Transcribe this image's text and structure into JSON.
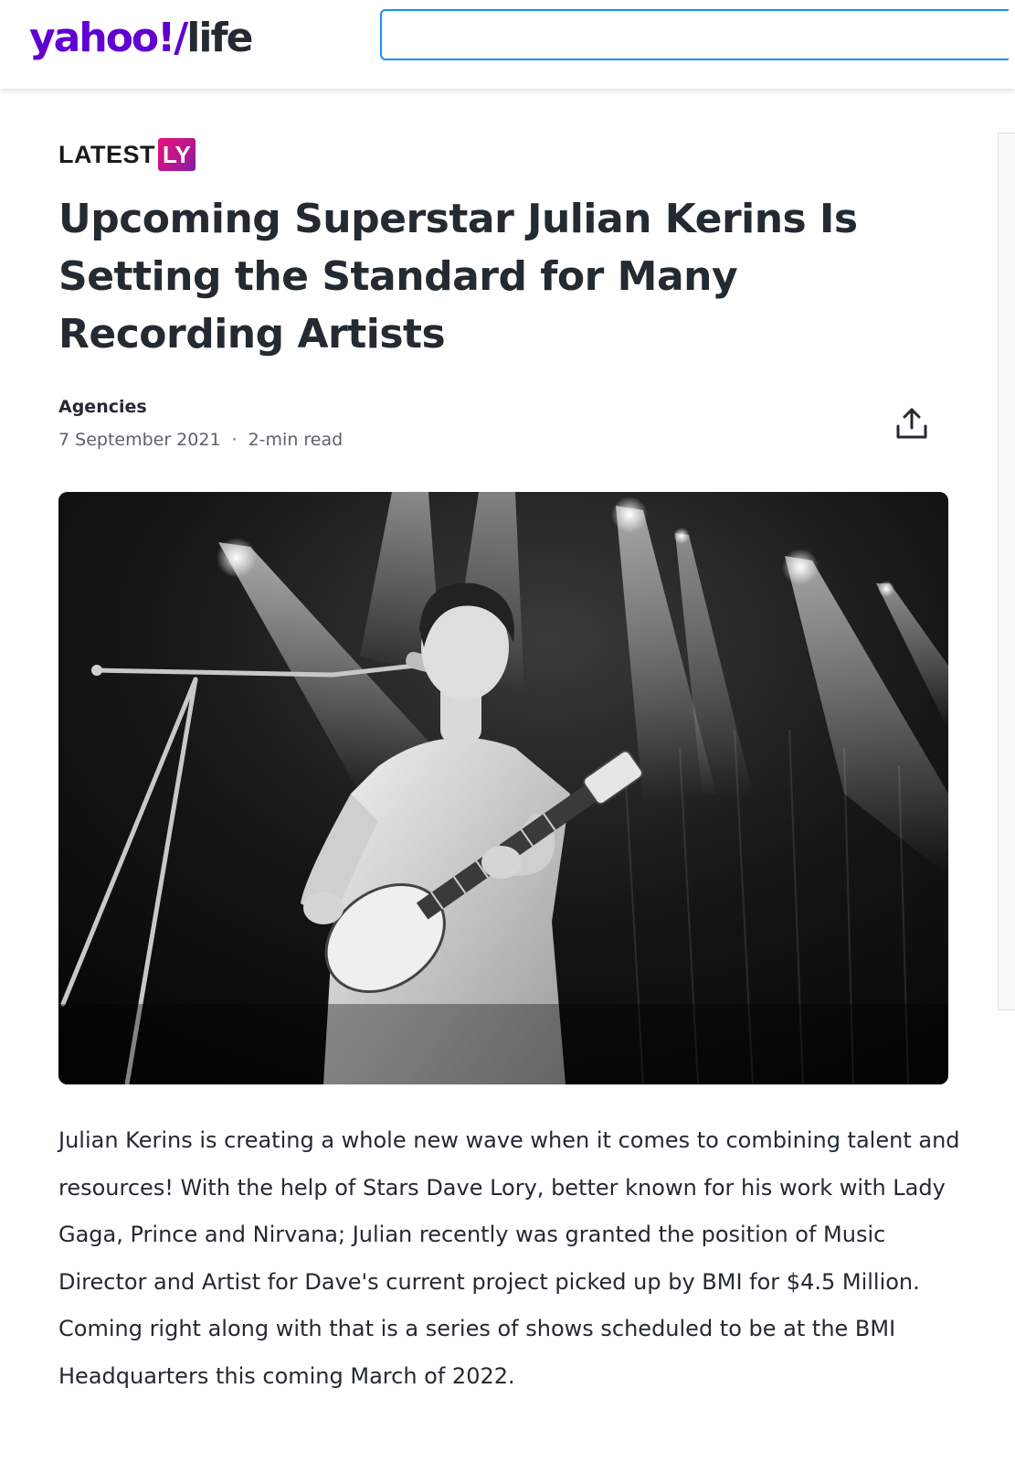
{
  "header": {
    "logo_brand": "yahoo",
    "logo_slash": "!/",
    "logo_section": "life",
    "search_value": "",
    "brand_color": "#6001d2",
    "search_border_color": "#188fff"
  },
  "article": {
    "provider": "LATEST",
    "provider_badge": "LY",
    "title": "Upcoming Superstar Julian Kerins Is Setting the Standard for Many Recording Artists",
    "author": "Agencies",
    "date": "7 September 2021",
    "separator": "·",
    "read_time": "2-min read",
    "share_icon": "share-icon",
    "body": "Julian Kerins is creating a whole new wave when it comes to combining talent and resources! With the help of Stars Dave Lory, better known for his work with Lady Gaga, Prince and Nirvana; Julian recently was granted the position of Music Director and Artist for Dave's current project picked up by BMI for $4.5 Million. Coming right along with that is a series of shows scheduled to be at the BMI Headquarters this coming March of 2022."
  }
}
